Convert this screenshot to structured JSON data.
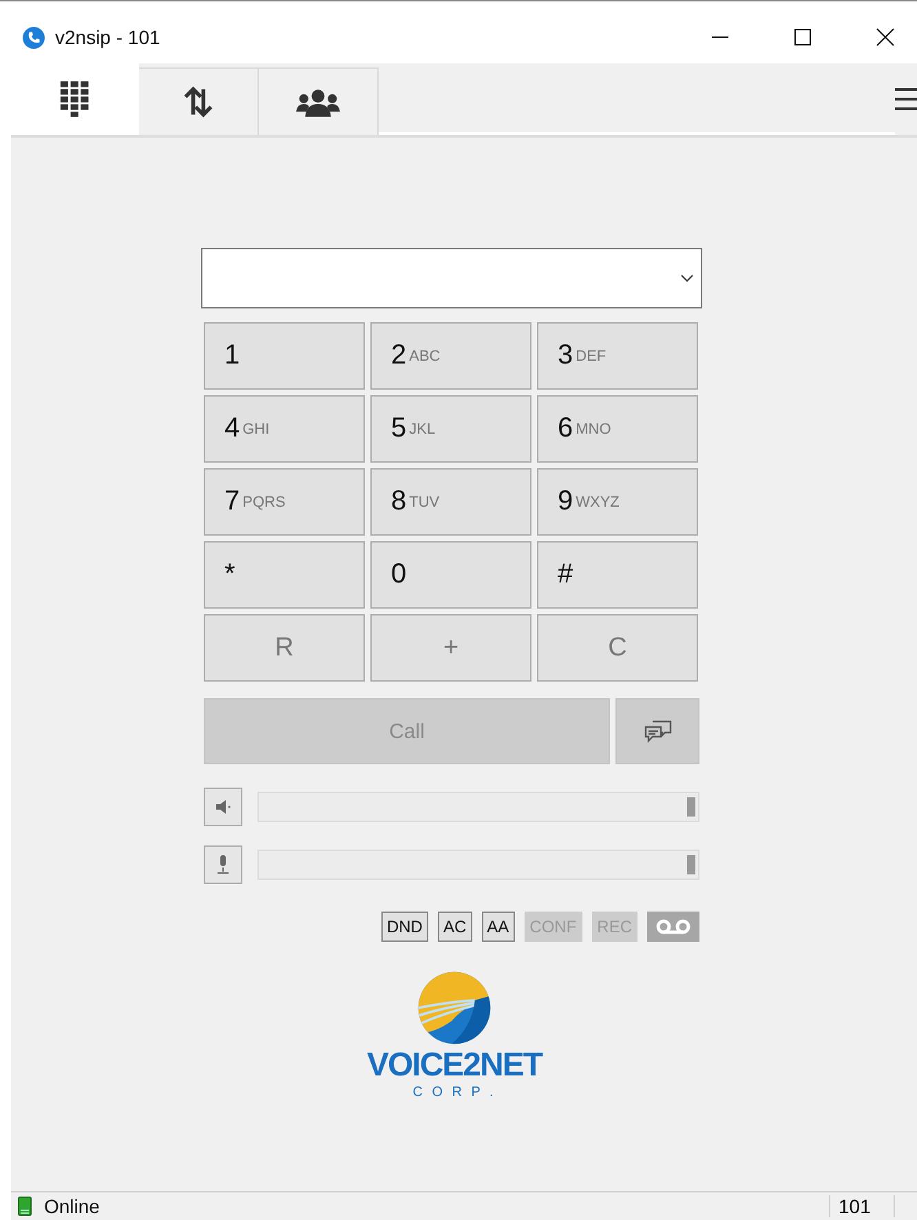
{
  "window": {
    "title": "v2nsip - 101"
  },
  "tabs": [
    {
      "kind": "dialpad",
      "selected": true
    },
    {
      "kind": "transfer",
      "selected": false
    },
    {
      "kind": "contacts",
      "selected": false
    }
  ],
  "keypad": [
    {
      "digit": "1"
    },
    {
      "digit": "2",
      "letters": "ABC"
    },
    {
      "digit": "3",
      "letters": "DEF"
    },
    {
      "digit": "4",
      "letters": "GHI"
    },
    {
      "digit": "5",
      "letters": "JKL"
    },
    {
      "digit": "6",
      "letters": "MNO"
    },
    {
      "digit": "7",
      "letters": "PQRS"
    },
    {
      "digit": "8",
      "letters": "TUV"
    },
    {
      "digit": "9",
      "letters": "WXYZ"
    },
    {
      "digit": "*"
    },
    {
      "digit": "0"
    },
    {
      "digit": "#"
    }
  ],
  "function_keys": [
    "R",
    "+",
    "C"
  ],
  "call_button": {
    "label": "Call",
    "disabled": true
  },
  "sliders": [
    {
      "kind": "speaker",
      "level": 1
    },
    {
      "kind": "microphone",
      "level": 1
    }
  ],
  "toggles": [
    {
      "label": "DND",
      "disabled": false
    },
    {
      "label": "AC",
      "disabled": false
    },
    {
      "label": "AA",
      "disabled": false
    },
    {
      "label": "CONF",
      "disabled": true
    },
    {
      "label": "REC",
      "disabled": true
    }
  ],
  "logo": {
    "name": "VOICE2NET",
    "sub": "C O R P ."
  },
  "status_bar": {
    "status": "Online",
    "extension": "101"
  }
}
